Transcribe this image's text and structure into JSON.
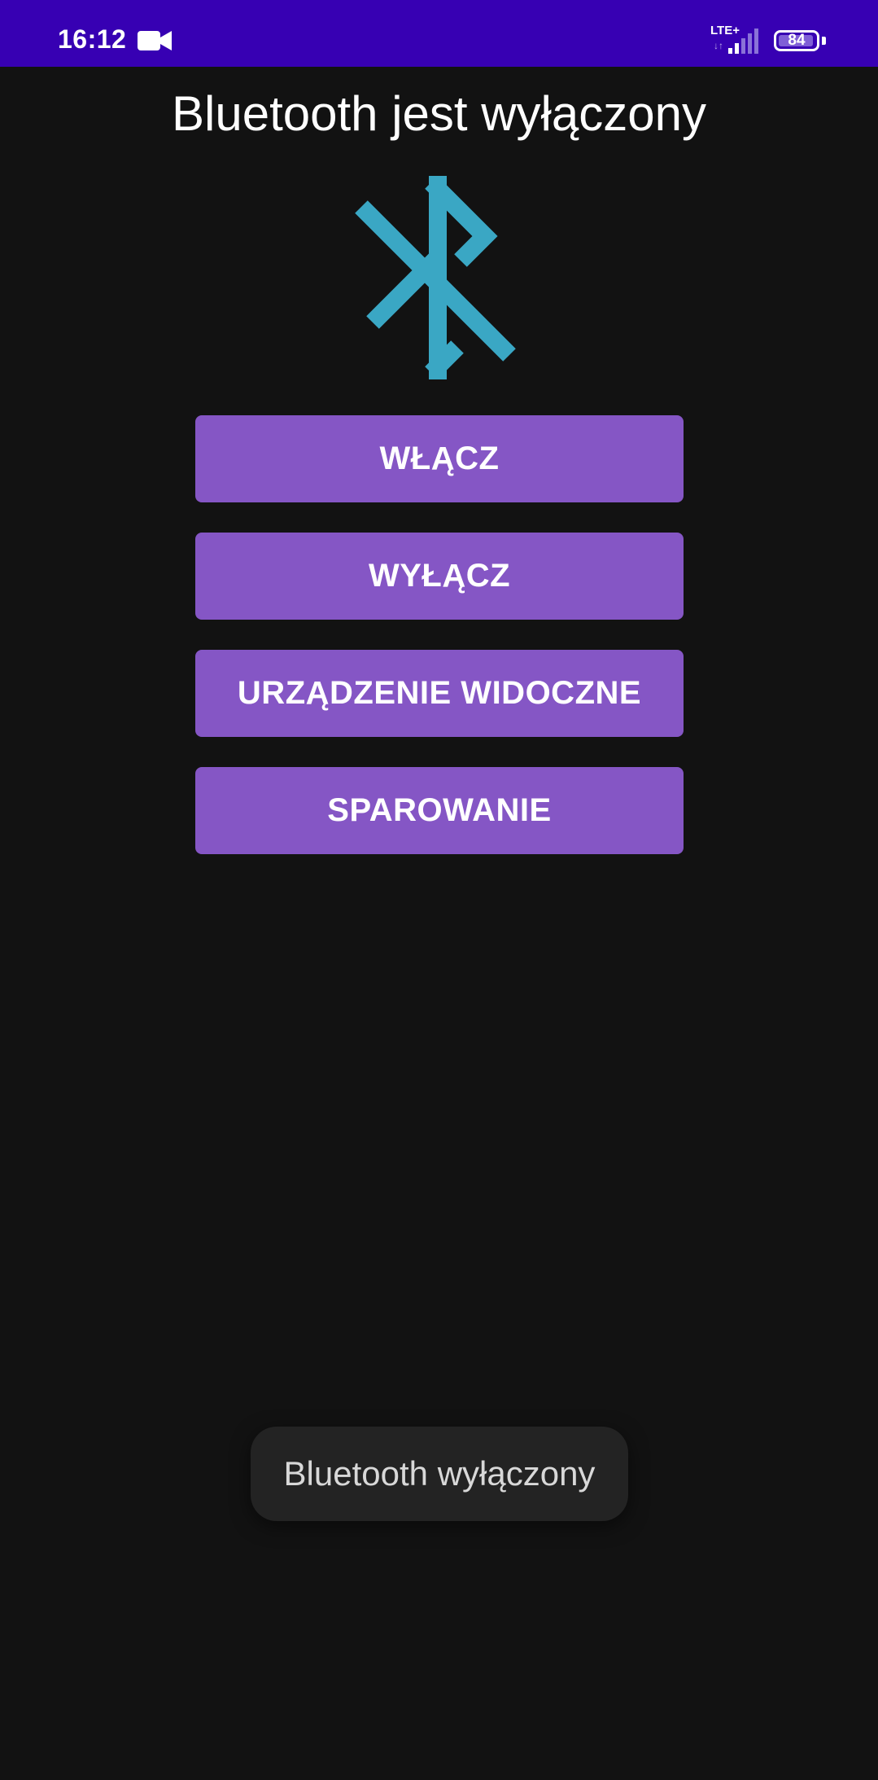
{
  "status_bar": {
    "time": "16:12",
    "network_type": "LTE+",
    "data_arrows": "↓↑",
    "battery_level": "84",
    "background": "#3700b3",
    "icons": [
      "video-camera-icon",
      "signal-icon",
      "battery-icon"
    ]
  },
  "page": {
    "title": "Bluetooth jest wyłączony",
    "logo_icon": "bluetooth-icon",
    "logo_color": "#3aa7c4",
    "background": "#121212"
  },
  "buttons": [
    {
      "label": "WŁĄCZ"
    },
    {
      "label": "WYŁĄCZ"
    },
    {
      "label": "URZĄDZENIE WIDOCZNE"
    },
    {
      "label": "SPAROWANIE"
    }
  ],
  "button_color": "#8556c5",
  "toast": {
    "message": "Bluetooth wyłączony"
  }
}
